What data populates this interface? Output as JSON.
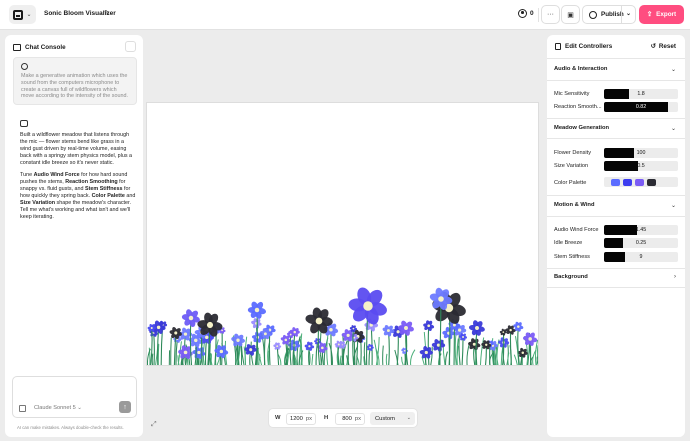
{
  "header": {
    "app_title": "Sonic Bloom Visualizer",
    "user_count": "0",
    "publish_label": "Publish",
    "export_label": "Export"
  },
  "chat": {
    "title": "Chat Console",
    "user_message": "Make a generative animation which uses the sound from the computers microphone to create a canvas full of wildflowers which move according to the intensity of the sound.",
    "assistant_p1": "Built a wildflower meadow that listens through the mic — flower stems bend like grass in a wind gust driven by real-time volume, easing back with a springy stem physics model, plus a constant idle breeze so it's never static.",
    "assistant_p2_parts": [
      "Tune ",
      "Audio Wind Force",
      " for how hard sound pushes the stems, ",
      "Reaction Smoothing",
      " for snappy vs. fluid gusts, and ",
      "Stem Stiffness",
      " for how quickly they spring back. ",
      "Color Palette",
      " and ",
      "Size Variation",
      " shape the meadow's character. Tell me what's working and what isn't and we'll keep iterating."
    ],
    "model_label": "Claude Sonnet 5",
    "disclaimer": "AI can make mistakes. Always double-check the results."
  },
  "sizebar": {
    "w_label": "W",
    "w_value": "1200",
    "h_label": "H",
    "h_value": "800",
    "unit": "px",
    "preset": "Custom"
  },
  "controls": {
    "title": "Edit Controllers",
    "reset_label": "Reset",
    "sections": {
      "audio": {
        "title": "Audio & Interaction",
        "mic_label": "Mic Sensitivity",
        "mic_value": "1.8",
        "mic_fill": 0.34,
        "smooth_label": "Reaction Smooth...",
        "smooth_value": "0.82",
        "smooth_fill": 0.86
      },
      "meadow": {
        "title": "Meadow Generation",
        "density_label": "Flower Density",
        "density_value": "100",
        "density_fill": 0.4,
        "size_label": "Size Variation",
        "size_value": "0.5",
        "size_fill": 0.46,
        "palette_label": "Color Palette",
        "palette_colors": [
          "#5b6cff",
          "#3d3df0",
          "#7b5cf5",
          "#2b2b33"
        ]
      },
      "motion": {
        "title": "Motion & Wind",
        "wind_label": "Audio Wind Force",
        "wind_value": "1.45",
        "wind_fill": 0.44,
        "breeze_label": "Idle Breeze",
        "breeze_value": "0.25",
        "breeze_fill": 0.26,
        "stiff_label": "Stem Stiffness",
        "stiff_value": "9",
        "stiff_fill": 0.28
      },
      "background": {
        "title": "Background"
      }
    }
  }
}
